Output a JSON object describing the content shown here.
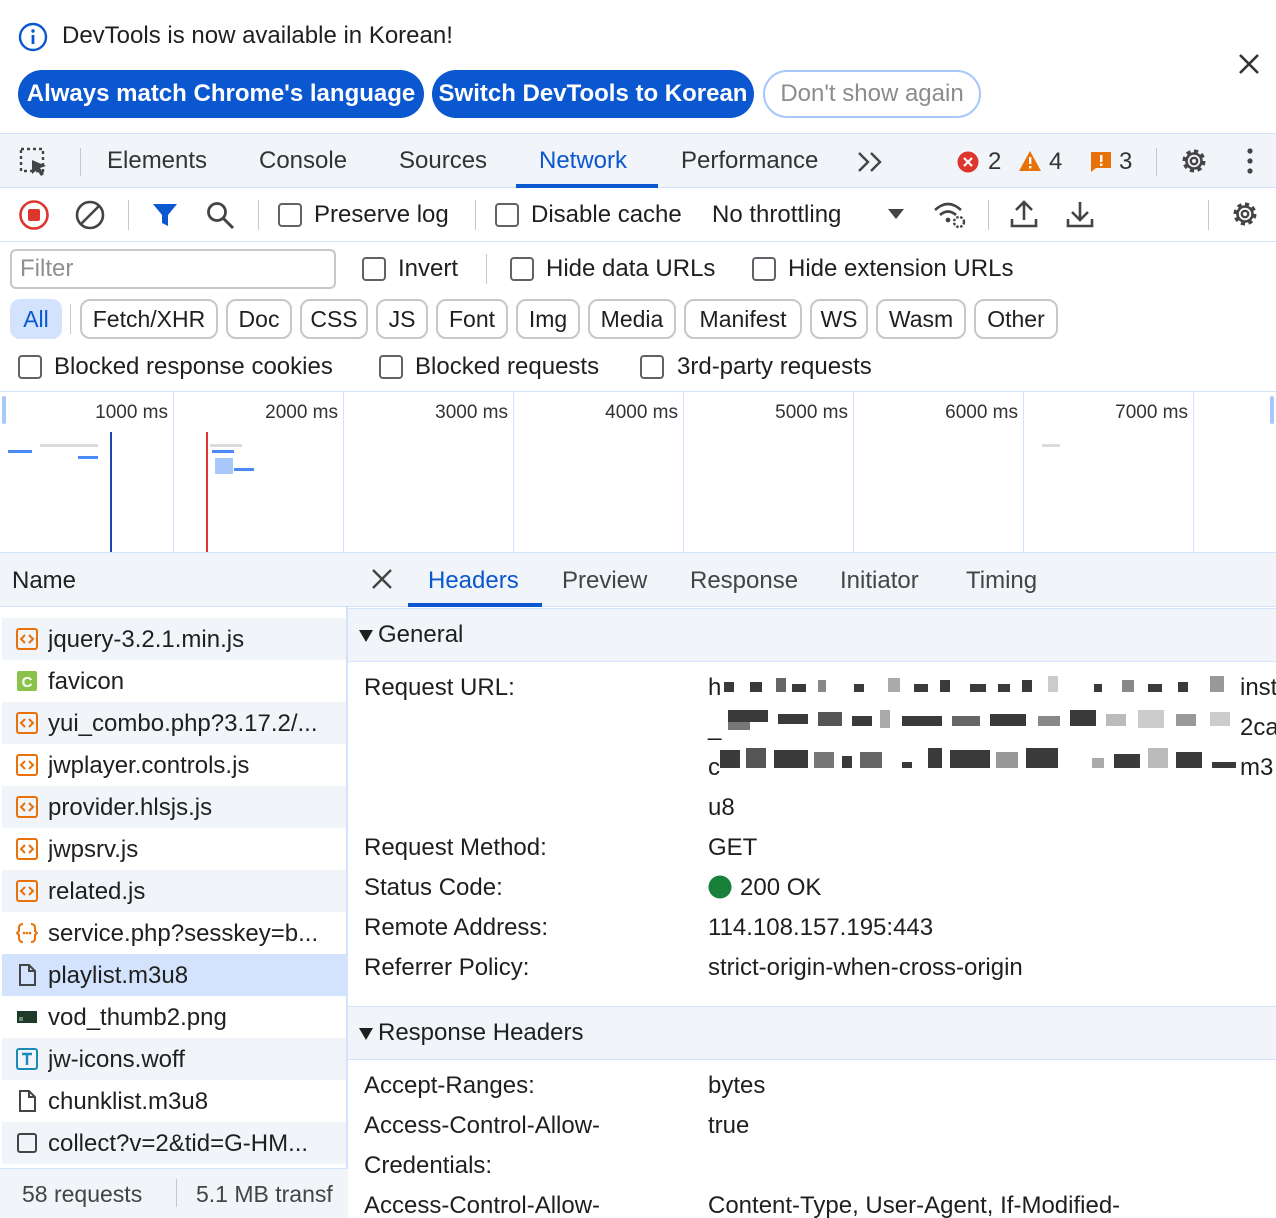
{
  "banner": {
    "message": "DevTools is now available in Korean!",
    "buttons": [
      "Always match Chrome's language",
      "Switch DevTools to Korean",
      "Don't show again"
    ]
  },
  "tabs": [
    "Elements",
    "Console",
    "Sources",
    "Network",
    "Performance"
  ],
  "active_tab": "Network",
  "counters": {
    "errors": "2",
    "warnings": "4",
    "issues": "3"
  },
  "toolbar": {
    "preserve_log": "Preserve log",
    "disable_cache": "Disable cache",
    "throttling": "No throttling"
  },
  "filter": {
    "placeholder": "Filter",
    "invert": "Invert",
    "hide_data_urls": "Hide data URLs",
    "hide_extension_urls": "Hide extension URLs",
    "types": [
      "All",
      "Fetch/XHR",
      "Doc",
      "CSS",
      "JS",
      "Font",
      "Img",
      "Media",
      "Manifest",
      "WS",
      "Wasm",
      "Other"
    ],
    "active_type": "All",
    "blocked_response_cookies": "Blocked response cookies",
    "blocked_requests": "Blocked requests",
    "third_party": "3rd-party requests"
  },
  "overview": {
    "ticks": [
      "1000 ms",
      "2000 ms",
      "3000 ms",
      "4000 ms",
      "5000 ms",
      "6000 ms",
      "7000 ms"
    ]
  },
  "requests": {
    "header": "Name",
    "items": [
      {
        "name": "jquery-3.2.1.min.js",
        "type": "script"
      },
      {
        "name": "favicon",
        "type": "css"
      },
      {
        "name": "yui_combo.php?3.17.2/...",
        "type": "script"
      },
      {
        "name": "jwplayer.controls.js",
        "type": "script"
      },
      {
        "name": "provider.hlsjs.js",
        "type": "script"
      },
      {
        "name": "jwpsrv.js",
        "type": "script"
      },
      {
        "name": "related.js",
        "type": "script"
      },
      {
        "name": "service.php?sesskey=b...",
        "type": "json"
      },
      {
        "name": "playlist.m3u8",
        "type": "document",
        "selected": true
      },
      {
        "name": "vod_thumb2.png",
        "type": "image"
      },
      {
        "name": "jw-icons.woff",
        "type": "font"
      },
      {
        "name": "chunklist.m3u8",
        "type": "document"
      },
      {
        "name": "collect?v=2&tid=G-HM...",
        "type": "other"
      }
    ],
    "footer_requests": "58 requests",
    "footer_transfer": "5.1 MB transf"
  },
  "details": {
    "tabs": [
      "Headers",
      "Preview",
      "Response",
      "Initiator",
      "Timing"
    ],
    "active_tab": "Headers",
    "general_title": "General",
    "general": {
      "request_url_label": "Request URL:",
      "request_url_fragments": [
        "h",
        "inst",
        "_",
        "2ca",
        "c",
        "m3",
        "u8"
      ],
      "request_method_label": "Request Method:",
      "request_method": "GET",
      "status_code_label": "Status Code:",
      "status_code": "200 OK",
      "remote_address_label": "Remote Address:",
      "remote_address": "114.108.157.195:443",
      "referrer_policy_label": "Referrer Policy:",
      "referrer_policy": "strict-origin-when-cross-origin"
    },
    "response_title": "Response Headers",
    "response": {
      "accept_ranges_label": "Accept-Ranges:",
      "accept_ranges": "bytes",
      "acac_label_1": "Access-Control-Allow-",
      "acac_label_2": "Credentials:",
      "acac": "true",
      "acah_label": "Access-Control-Allow-",
      "acah": "Content-Type, User-Agent, If-Modified-"
    }
  },
  "colors": {
    "accent": "#0b57d0",
    "tab_bg": "#f1f4f9",
    "selected": "#d3e3fd",
    "error": "#dc362e",
    "warning": "#e8710a",
    "ok": "#188038"
  }
}
